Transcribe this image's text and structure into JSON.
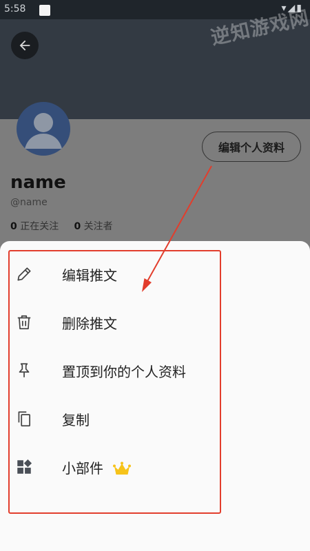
{
  "status_bar": {
    "time": "5:58",
    "signal_icons": "▾◢▮"
  },
  "watermark": "逆知游戏网",
  "header": {
    "back_icon": "arrow-left-icon"
  },
  "profile": {
    "name": "name",
    "handle": "@name",
    "following_count": "0",
    "following_label": "正在关注",
    "followers_count": "0",
    "followers_label": "关注者",
    "edit_profile_label": "编辑个人资料"
  },
  "menu": {
    "items": [
      {
        "label": "编辑推文",
        "icon": "pencil-icon"
      },
      {
        "label": "删除推文",
        "icon": "trash-icon"
      },
      {
        "label": "置顶到你的个人资料",
        "icon": "pin-icon"
      },
      {
        "label": "复制",
        "icon": "copy-icon"
      },
      {
        "label": "小部件",
        "icon": "widgets-icon",
        "badge_icon": "crown-icon"
      }
    ]
  },
  "colors": {
    "highlight": "#e23d2c",
    "crown": "#f6c31a"
  }
}
